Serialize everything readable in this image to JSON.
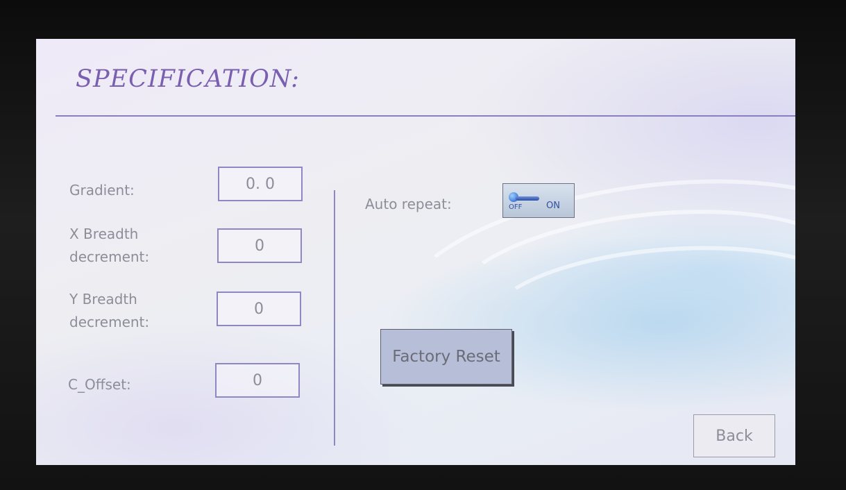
{
  "header": {
    "title": "SPECIFICATION:"
  },
  "fields": {
    "gradient": {
      "label": "Gradient:",
      "value": "0. 0"
    },
    "x_breadth": {
      "label_line1": "X Breadth",
      "label_line2": "decrement:",
      "value": "0"
    },
    "y_breadth": {
      "label_line1": "Y Breadth",
      "label_line2": "decrement:",
      "value": "0"
    },
    "c_offset": {
      "label": "C_Offset:",
      "value": "0"
    }
  },
  "auto_repeat": {
    "label": "Auto repeat:",
    "toggle": {
      "off_text": "OFF",
      "on_text": "ON",
      "state": "on",
      "icon": "toggle-switch-icon"
    }
  },
  "buttons": {
    "factory_reset": "Factory Reset",
    "back": "Back"
  },
  "colors": {
    "title": "#7a5fb0",
    "rule": "#8c7cc0",
    "field_border": "#8f86c4",
    "reset_button": "#b6bed8"
  }
}
